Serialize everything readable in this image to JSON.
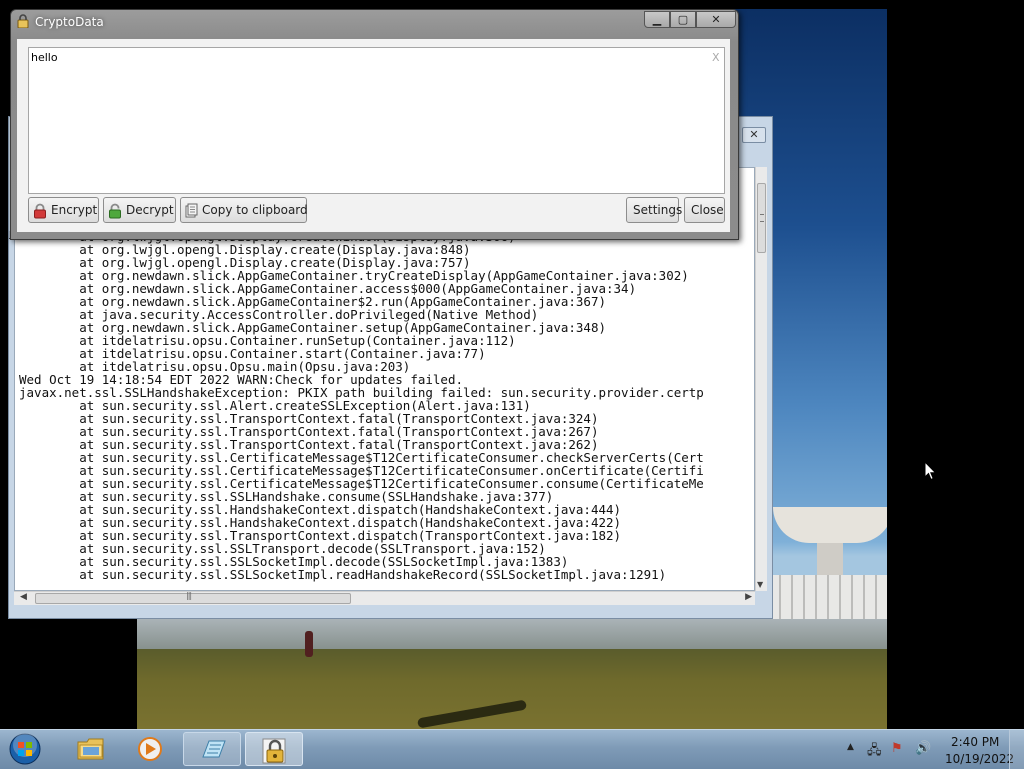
{
  "crypto_window": {
    "title": "CryptoData",
    "buttons": {
      "minimize": "▭",
      "maximize": "▢",
      "close": "✕"
    },
    "textarea_value": "hello",
    "clear_label": "X",
    "actions": {
      "encrypt": "Encrypt",
      "decrypt": "Decrypt",
      "copy": "Copy to clipboard",
      "settings": "Settings",
      "close": "Close"
    },
    "icons": {
      "encrypt": "padlock-closed-red-icon",
      "decrypt": "padlock-open-green-icon",
      "copy": "clipboard-icon"
    }
  },
  "console_window": {
    "close_label": "✕",
    "left_glimpse": "L",
    "lines": [
      "        at org.lwjgl.opengl.Display.createWindow(Display.java:306)",
      "        at org.lwjgl.opengl.Display.create(Display.java:848)",
      "        at org.lwjgl.opengl.Display.create(Display.java:757)",
      "        at org.newdawn.slick.AppGameContainer.tryCreateDisplay(AppGameContainer.java:302)",
      "        at org.newdawn.slick.AppGameContainer.access$000(AppGameContainer.java:34)",
      "        at org.newdawn.slick.AppGameContainer$2.run(AppGameContainer.java:367)",
      "        at java.security.AccessController.doPrivileged(Native Method)",
      "        at org.newdawn.slick.AppGameContainer.setup(AppGameContainer.java:348)",
      "        at itdelatrisu.opsu.Container.runSetup(Container.java:112)",
      "        at itdelatrisu.opsu.Container.start(Container.java:77)",
      "        at itdelatrisu.opsu.Opsu.main(Opsu.java:203)",
      "Wed Oct 19 14:18:54 EDT 2022 WARN:Check for updates failed.",
      "javax.net.ssl.SSLHandshakeException: PKIX path building failed: sun.security.provider.certp",
      "        at sun.security.ssl.Alert.createSSLException(Alert.java:131)",
      "        at sun.security.ssl.TransportContext.fatal(TransportContext.java:324)",
      "        at sun.security.ssl.TransportContext.fatal(TransportContext.java:267)",
      "        at sun.security.ssl.TransportContext.fatal(TransportContext.java:262)",
      "        at sun.security.ssl.CertificateMessage$T12CertificateConsumer.checkServerCerts(Cert",
      "        at sun.security.ssl.CertificateMessage$T12CertificateConsumer.onCertificate(Certifi",
      "        at sun.security.ssl.CertificateMessage$T12CertificateConsumer.consume(CertificateMe",
      "        at sun.security.ssl.SSLHandshake.consume(SSLHandshake.java:377)",
      "        at sun.security.ssl.HandshakeContext.dispatch(HandshakeContext.java:444)",
      "        at sun.security.ssl.HandshakeContext.dispatch(HandshakeContext.java:422)",
      "        at sun.security.ssl.TransportContext.dispatch(TransportContext.java:182)",
      "        at sun.security.ssl.SSLTransport.decode(SSLTransport.java:152)",
      "        at sun.security.ssl.SSLSocketImpl.decode(SSLSocketImpl.java:1383)",
      "        at sun.security.ssl.SSLSocketImpl.readHandshakeRecord(SSLSocketImpl.java:1291)"
    ]
  },
  "taskbar": {
    "items": [
      {
        "name": "start",
        "icon": "windows-start-orb-icon"
      },
      {
        "name": "explorer",
        "icon": "folder-icon"
      },
      {
        "name": "media-player",
        "icon": "media-player-icon"
      },
      {
        "name": "notepad",
        "icon": "notepad-icon"
      },
      {
        "name": "cryptodata",
        "icon": "padlock-icon"
      }
    ],
    "tray": {
      "icons": [
        "show-hidden-icons-arrow-icon",
        "network-icon",
        "action-center-flag-icon",
        "volume-icon"
      ],
      "time": "2:40 PM",
      "date": "10/19/2022"
    }
  },
  "colors": {
    "taskbar": "#7f9bb7",
    "window_frame": "#8c8c8c",
    "console_frame": "#c7d6e6",
    "encrypt_lock": "#d23a3a",
    "decrypt_lock": "#4fa83d"
  }
}
